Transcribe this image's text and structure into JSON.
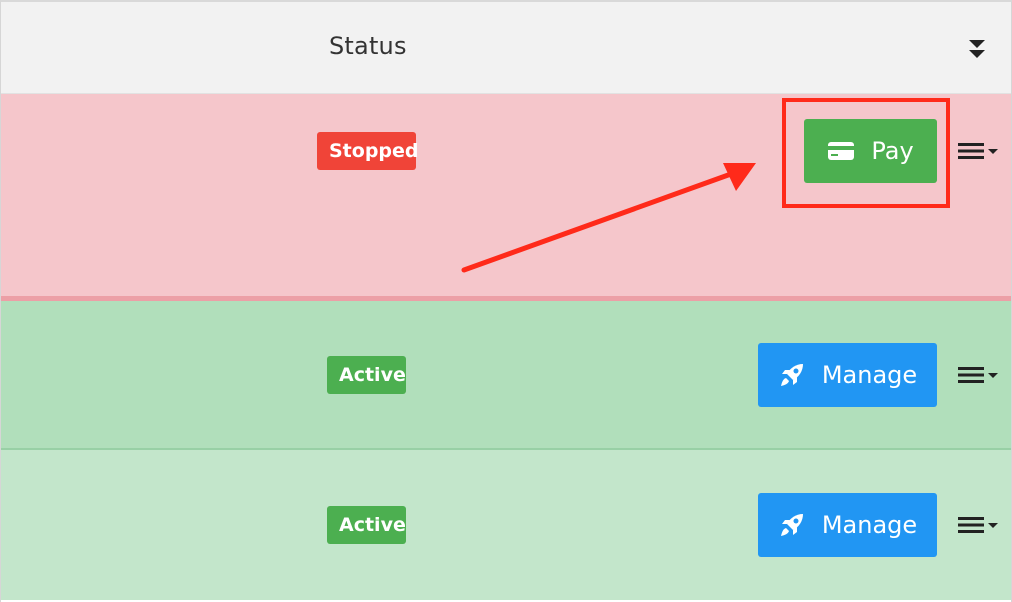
{
  "header": {
    "status_label": "Status",
    "sort_icon": "sort-desc-icon"
  },
  "rows": [
    {
      "status": "Stopped",
      "status_color": "#f04438",
      "row_color": "#f5c6cb",
      "action_label": "Pay",
      "action_icon": "credit-card-icon",
      "action_color": "#4caf50",
      "menu_icon": "menu-dropdown-icon"
    },
    {
      "status": "Active",
      "status_color": "#4caf50",
      "row_color": "#b1dfbb",
      "action_label": "Manage",
      "action_icon": "rocket-icon",
      "action_color": "#2196f3",
      "menu_icon": "menu-dropdown-icon"
    },
    {
      "status": "Active",
      "status_color": "#4caf50",
      "row_color": "#c3e6cb",
      "action_label": "Manage",
      "action_icon": "rocket-icon",
      "action_color": "#2196f3",
      "menu_icon": "menu-dropdown-icon"
    }
  ],
  "annotation": {
    "highlight_color": "#ff2a1a"
  }
}
